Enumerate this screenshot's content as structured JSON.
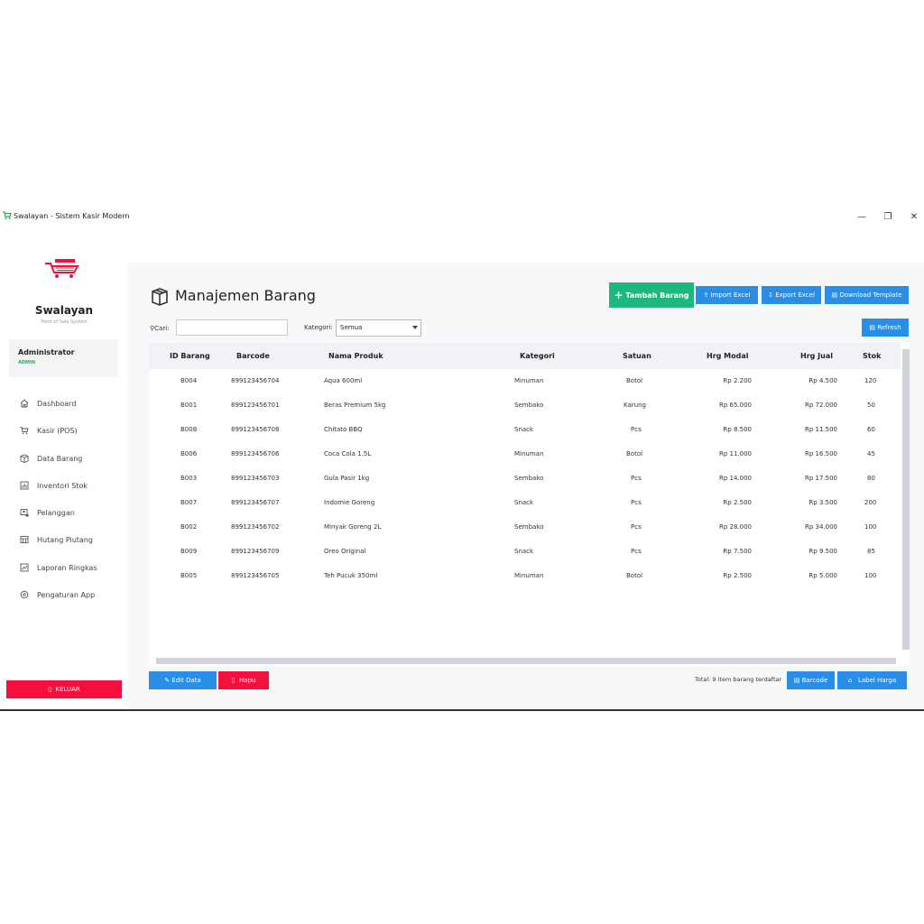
{
  "window": {
    "title": "Swalayan - Sistem Kasir Modern",
    "minimize": "—",
    "restore": "❐",
    "close": "✕"
  },
  "sidebar": {
    "brand": "Swalayan",
    "tagline": "Point of Sale System",
    "user": {
      "name": "Administrator",
      "role": "ADMIN"
    },
    "items": [
      {
        "label": "Dashboard",
        "icon": "home-icon"
      },
      {
        "label": "Kasir (POS)",
        "icon": "cart-icon"
      },
      {
        "label": "Data Barang",
        "icon": "box-icon"
      },
      {
        "label": "Inventori Stok",
        "icon": "chart-icon"
      },
      {
        "label": "Pelanggan",
        "icon": "customer-icon"
      },
      {
        "label": "Hutang Piutang",
        "icon": "ledger-icon"
      },
      {
        "label": "Laporan Ringkas",
        "icon": "report-icon"
      },
      {
        "label": "Pengaturan App",
        "icon": "settings-icon"
      }
    ],
    "logout": "KELUAR"
  },
  "main": {
    "title": "Manajemen Barang",
    "actions": {
      "add": "Tambah Barang",
      "import": "Import Excel",
      "export": "Export Excel",
      "template": "Download Template",
      "refresh": "Refresh"
    },
    "search": {
      "label": "Cari:",
      "value": ""
    },
    "filter": {
      "label": "Kategori:",
      "selected": "Semua"
    },
    "table": {
      "columns": [
        "ID Barang",
        "Barcode",
        "Nama Produk",
        "Kategori",
        "Satuan",
        "Hrg Modal",
        "Hrg Jual",
        "Stok"
      ],
      "rows": [
        [
          "B004",
          "899123456704",
          "Aqua 600ml",
          "Minuman",
          "Botol",
          "Rp 2.200",
          "Rp 4.500",
          "120"
        ],
        [
          "B001",
          "899123456701",
          "Beras Premium 5kg",
          "Sembako",
          "Karung",
          "Rp 65.000",
          "Rp 72.000",
          "50"
        ],
        [
          "B008",
          "899123456708",
          "Chitato BBQ",
          "Snack",
          "Pcs",
          "Rp 8.500",
          "Rp 11.500",
          "60"
        ],
        [
          "B006",
          "899123456706",
          "Coca Cola 1.5L",
          "Minuman",
          "Botol",
          "Rp 11.000",
          "Rp 16.500",
          "45"
        ],
        [
          "B003",
          "899123456703",
          "Gula Pasir 1kg",
          "Sembako",
          "Pcs",
          "Rp 14.000",
          "Rp 17.500",
          "80"
        ],
        [
          "B007",
          "899123456707",
          "Indomie Goreng",
          "Snack",
          "Pcs",
          "Rp 2.500",
          "Rp 3.500",
          "200"
        ],
        [
          "B002",
          "899123456702",
          "Minyak Goreng 2L",
          "Sembako",
          "Pcs",
          "Rp 28.000",
          "Rp 34.000",
          "100"
        ],
        [
          "B009",
          "899123456709",
          "Oreo Original",
          "Snack",
          "Pcs",
          "Rp 7.500",
          "Rp 9.500",
          "85"
        ],
        [
          "B005",
          "899123456705",
          "Teh Pucuk 350ml",
          "Minuman",
          "Botol",
          "Rp 2.500",
          "Rp 5.000",
          "100"
        ]
      ]
    },
    "footer": {
      "edit": "Edit Data",
      "delete": "Hapu",
      "total": "Total: 9 item barang terdaftar",
      "barcode": "Barcode",
      "label": "Label Harga"
    }
  },
  "colors": {
    "accent_blue": "#2a8de6",
    "accent_green": "#1cb87d",
    "danger_red": "#f50f3c",
    "role_green": "#27ae60"
  }
}
